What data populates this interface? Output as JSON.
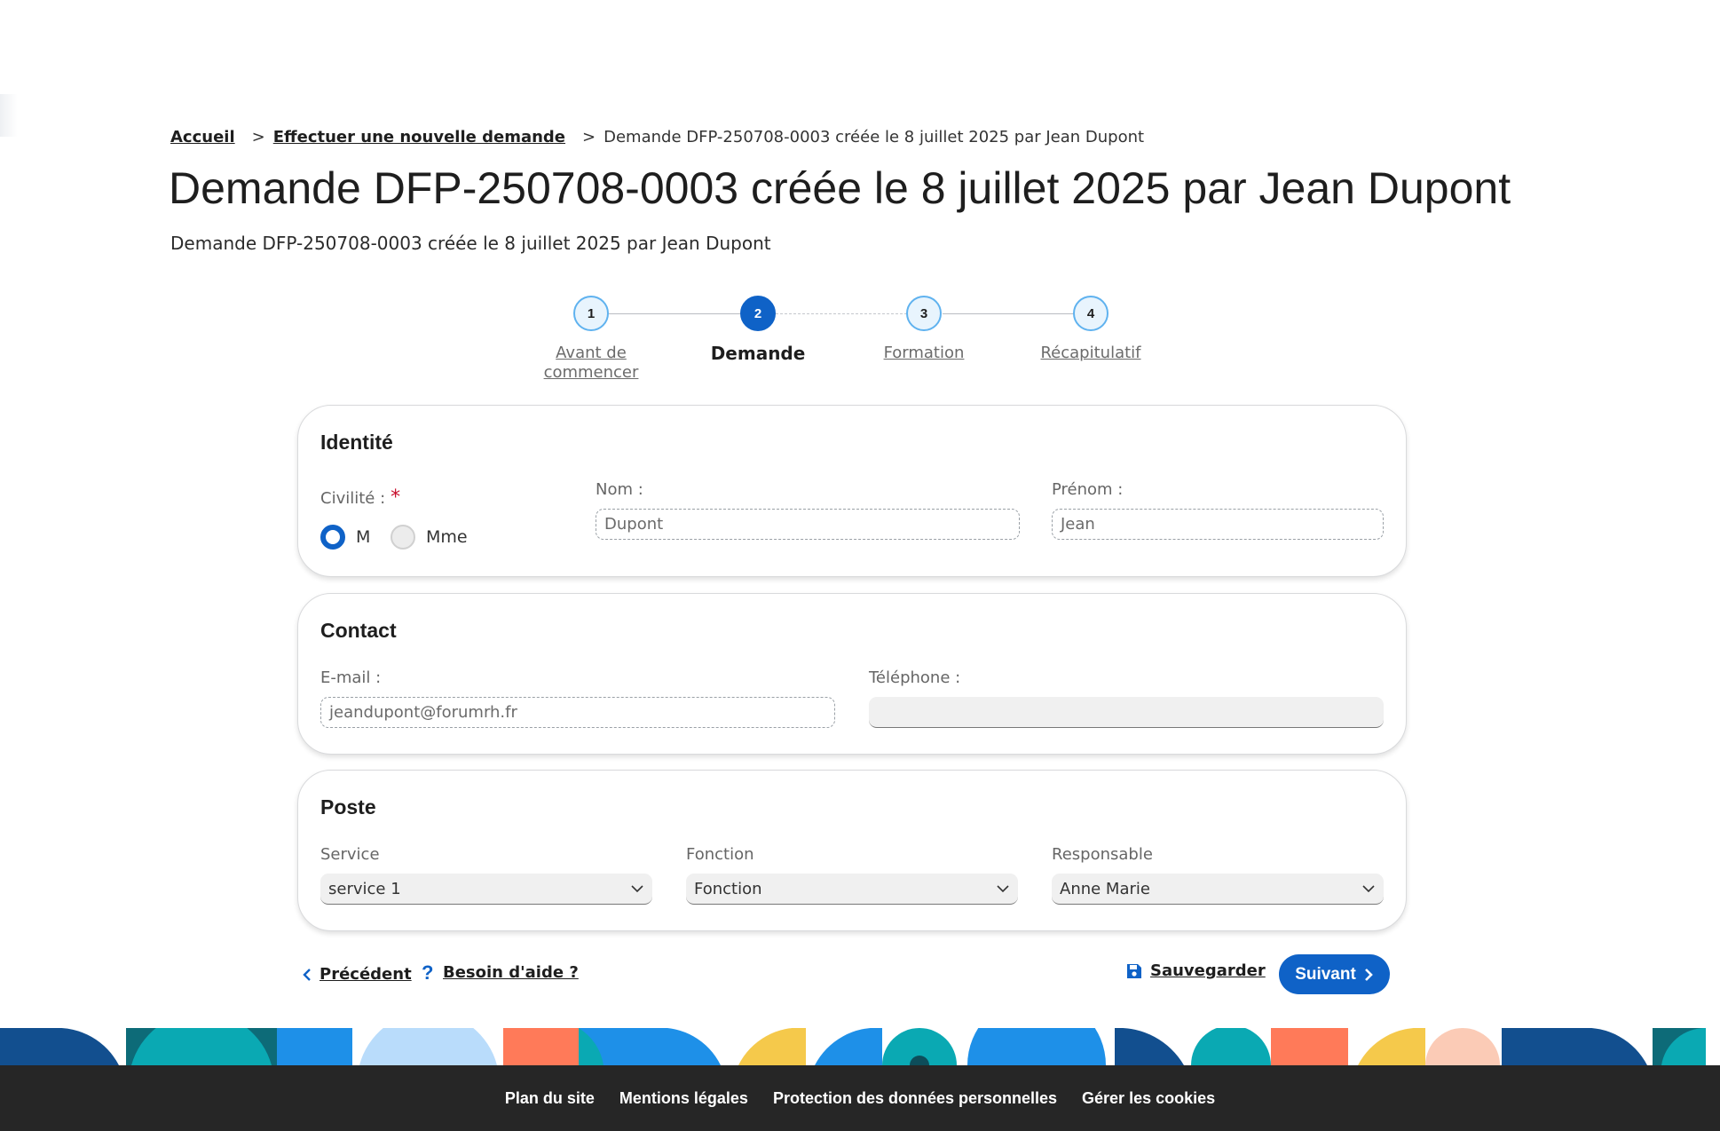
{
  "breadcrumb": {
    "home": "Accueil",
    "separator": ">",
    "parent": "Effectuer une nouvelle demande",
    "current": "Demande DFP-250708-0003 créée le 8 juillet 2025 par Jean Dupont"
  },
  "page": {
    "title": "Demande DFP-250708-0003 créée le 8 juillet 2025 par Jean Dupont",
    "subtitle": "Demande DFP-250708-0003 créée le 8 juillet 2025 par Jean Dupont"
  },
  "stepper": {
    "steps": [
      {
        "number": "1",
        "label": "Avant de commencer",
        "state": "done"
      },
      {
        "number": "2",
        "label": "Demande",
        "state": "active"
      },
      {
        "number": "3",
        "label": "Formation",
        "state": "todo"
      },
      {
        "number": "4",
        "label": "Récapitulatif",
        "state": "todo"
      }
    ]
  },
  "identity": {
    "title": "Identité",
    "civility_label": "Civilité :",
    "required_mark": "*",
    "options": [
      {
        "label": "M",
        "checked": true
      },
      {
        "label": "Mme",
        "checked": false
      }
    ],
    "last_name_label": "Nom :",
    "last_name_value": "Dupont",
    "first_name_label": "Prénom :",
    "first_name_value": "Jean"
  },
  "contact": {
    "title": "Contact",
    "email_label": "E-mail :",
    "email_value": "jeandupont@forumrh.fr",
    "phone_label": "Téléphone :",
    "phone_value": ""
  },
  "position": {
    "title": "Poste",
    "service_label": "Service",
    "service_value": "service 1",
    "function_label": "Fonction",
    "function_value": "Fonction",
    "manager_label": "Responsable",
    "manager_value": "Anne Marie"
  },
  "actions": {
    "previous": "Précédent",
    "help": "Besoin d'aide ?",
    "save": "Sauvegarder",
    "next": "Suivant"
  },
  "footer": {
    "links": [
      "Plan du site",
      "Mentions légales",
      "Protection des données personnelles",
      "Gérer les cookies"
    ]
  },
  "colors": {
    "primary": "#0f62c7",
    "step_border": "#5fb2ef",
    "required": "#c8102e",
    "footer_bg": "#262626"
  }
}
